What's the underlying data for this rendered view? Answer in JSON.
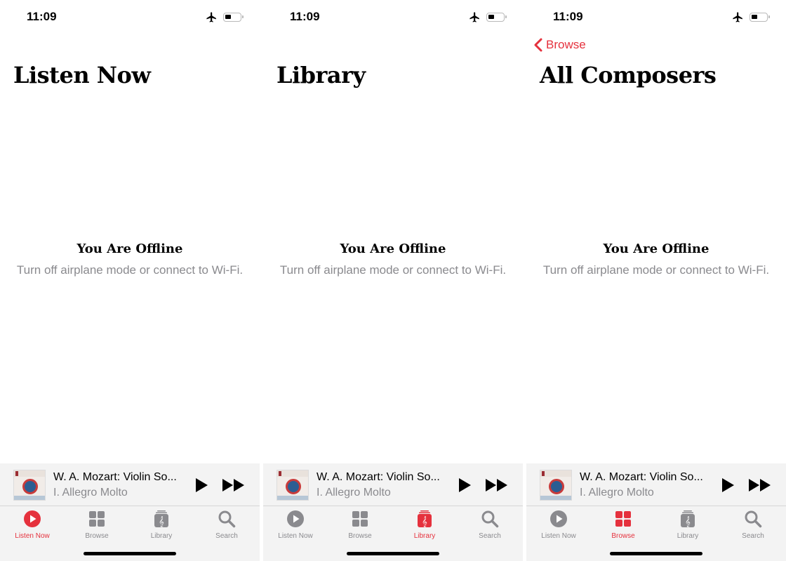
{
  "colors": {
    "accent": "#e5313d",
    "inactive": "#8a8a8e",
    "bar": "#f3f3f3"
  },
  "screens": [
    {
      "status": {
        "time": "11:09"
      },
      "back_label": "",
      "title": "Listen Now",
      "offline": {
        "title": "You Are Offline",
        "message": "Turn off airplane mode or connect to Wi-Fi."
      },
      "mini_player": {
        "title": "W. A. Mozart: Violin So...",
        "subtitle": "I. Allegro Molto"
      },
      "tabs": [
        {
          "label": "Listen Now"
        },
        {
          "label": "Browse"
        },
        {
          "label": "Library"
        },
        {
          "label": "Search"
        }
      ],
      "active_tab": "Listen Now"
    },
    {
      "status": {
        "time": "11:09"
      },
      "back_label": "",
      "title": "Library",
      "offline": {
        "title": "You Are Offline",
        "message": "Turn off airplane mode or connect to Wi-Fi."
      },
      "mini_player": {
        "title": "W. A. Mozart: Violin So...",
        "subtitle": "I. Allegro Molto"
      },
      "tabs": [
        {
          "label": "Listen Now"
        },
        {
          "label": "Browse"
        },
        {
          "label": "Library"
        },
        {
          "label": "Search"
        }
      ],
      "active_tab": "Library"
    },
    {
      "status": {
        "time": "11:09"
      },
      "back_label": "Browse",
      "title": "All Composers",
      "offline": {
        "title": "You Are Offline",
        "message": "Turn off airplane mode or connect to Wi-Fi."
      },
      "mini_player": {
        "title": "W. A. Mozart: Violin So...",
        "subtitle": "I. Allegro Molto"
      },
      "tabs": [
        {
          "label": "Listen Now"
        },
        {
          "label": "Browse"
        },
        {
          "label": "Library"
        },
        {
          "label": "Search"
        }
      ],
      "active_tab": "Browse"
    }
  ]
}
